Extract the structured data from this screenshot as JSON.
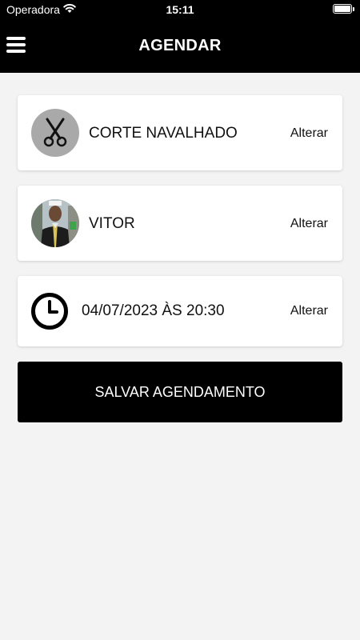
{
  "status_bar": {
    "carrier": "Operadora",
    "time": "15:11",
    "wifi_icon": "wifi-icon",
    "battery_icon": "battery-icon"
  },
  "header": {
    "menu_icon": "hamburger-menu-icon",
    "title": "AGENDAR"
  },
  "service": {
    "icon": "scissors-icon",
    "name": "CORTE NAVALHADO",
    "change_label": "Alterar"
  },
  "barber": {
    "avatar": "barber-photo",
    "name": "VITOR",
    "change_label": "Alterar"
  },
  "datetime": {
    "icon": "clock-icon",
    "value": "04/07/2023 ÀS 20:30",
    "change_label": "Alterar"
  },
  "save_button_label": "SALVAR AGENDAMENTO",
  "colors": {
    "header_bg": "#000000",
    "page_bg": "#f3f3f3",
    "card_bg": "#ffffff",
    "button_bg": "#000000",
    "service_avatar_bg": "#a9a9a9"
  }
}
